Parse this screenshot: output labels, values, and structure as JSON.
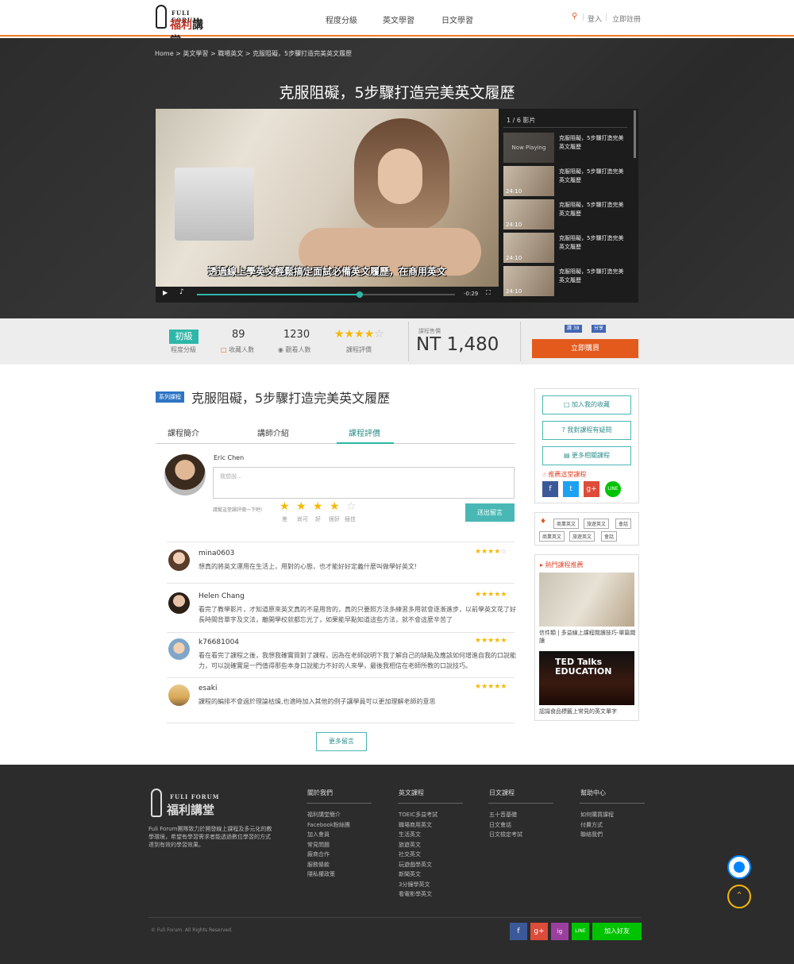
{
  "header": {
    "logo_en": "FULI FORUM",
    "logo_zh_a": "福利",
    "logo_zh_b": "講堂",
    "nav": [
      "程度分級",
      "英文學習",
      "日文學習"
    ],
    "login": "登入",
    "register": "立即註冊",
    "divider": "|"
  },
  "breadcrumb": "Home > 英文學習 > 職場英文 > 克服阻礙，5步驟打造完美英文履歷",
  "course_title": "克服阻礙，5步驟打造完美英文履歷",
  "video": {
    "subtitle": "透過線上學英文輕鬆搞定面試必備英文履歷，在商用英文",
    "time": "-0:29",
    "progress": 0.63
  },
  "playlist": {
    "header": "1 / 6 影片",
    "now_playing": "Now Playing",
    "items": [
      {
        "title": "克服阻礙，5步驟打造完美英文履歷",
        "duration": ""
      },
      {
        "title": "克服阻礙，5步驟打造完美英文履歷",
        "duration": "24:10"
      },
      {
        "title": "克服阻礙，5步驟打造完美英文履歷",
        "duration": "24:10"
      },
      {
        "title": "克服阻礙，5步驟打造完美英文履歷",
        "duration": "24:10"
      },
      {
        "title": "克服阻礙，5步驟打造完美英文履歷",
        "duration": "24:10"
      }
    ]
  },
  "info": {
    "level": "初級",
    "level_label": "程度分級",
    "favorites": "89",
    "favorites_label": "收藏人數",
    "views": "1230",
    "views_label": "觀看人數",
    "rating_label": "課程評價",
    "rating": 4,
    "price_label": "課程售價",
    "price": "NT 1,480",
    "like_label": "讚 38",
    "share_label": "分享",
    "buy_label": "立即購買"
  },
  "main": {
    "series_badge": "系列課程",
    "title": "克服阻礙，5步驟打造完美英文履歷",
    "tabs": [
      "課程簡介",
      "講師介紹",
      "課程評價"
    ],
    "active_tab": 2,
    "commenter": "Eric Chen",
    "comment_placeholder": "我想說...",
    "rate_prompt": "請幫這堂課評價一下吧!",
    "rate_scale": [
      "差",
      "尚可",
      "好",
      "很好",
      "極佳"
    ],
    "submit_label": "送出留言",
    "more_label": "更多留言"
  },
  "reviews": [
    {
      "name": "mina0603",
      "stars": 4,
      "text": "想真的將英文運用在生活上，用對的心態，也才能好好定義什麼叫做學好英文!"
    },
    {
      "name": "Helen Chang",
      "stars": 5,
      "text": "看完了教學影片，才知道原來英文真的不是用背的，真的只要照方法多練習多用就會逐漸進步，以前學英文花了好長時間背單字及文法，離開學校就都忘光了，如果能早點知道這些方法，就不會這麼辛苦了"
    },
    {
      "name": "k76681004",
      "stars": 5,
      "text": "看在看完了課程之後，我想我確實買對了課程，因為在老師說明下我了解自己的缺點及應該如何增進自我的口說能力，可以說確實是一門值得那些本身口說能力不好的人來學，最後我相信在老師所教的口說技巧。"
    },
    {
      "name": "esaki",
      "stars": 5,
      "text": "課程的編排不會過於理論枯燥,也適時加入其他的例子讓學員可以更加理解老師的意思"
    }
  ],
  "sidebar": {
    "buttons": [
      "加入我的收藏",
      "我對課程有疑問",
      "更多相關課程"
    ],
    "recommend_head": "推薦這堂課程",
    "social": [
      "f",
      "t",
      "g+",
      "LINE"
    ],
    "tags": [
      "商業英文",
      "旅遊英文",
      "會話",
      "商業英文",
      "旅遊英文",
      "會話"
    ],
    "hot_head": "熱門課程推薦",
    "hot": [
      {
        "caption": "信件類 | 多益線上課程閱讀技巧-單篇閱讀",
        "image_text": ""
      },
      {
        "caption": "認識食品標籤上常見的英文單字",
        "image_text": "TED Talks EDUCATION"
      }
    ]
  },
  "footer": {
    "logo_en": "FULI FORUM",
    "logo_zh": "福利講堂",
    "desc": "Fuli Forum團隊致力於開發線上課程及多元化的教學環境，希望有學習需求者能透過數位學習的方式達到有效的學習效果。",
    "cols": [
      {
        "head": "關於我們",
        "links": [
          "福利講堂簡介",
          "Facebook粉絲團",
          "加入會員",
          "常見問題",
          "廠商合作",
          "服務條款",
          "隱私權政策"
        ]
      },
      {
        "head": "英文課程",
        "links": [
          "TOEIC多益考試",
          "職場商用英文",
          "生活英文",
          "旅遊英文",
          "社交英文",
          "玩遊戲學英文",
          "新聞英文",
          "3分鐘學英文",
          "看電影學英文"
        ]
      },
      {
        "head": "日文課程",
        "links": [
          "五十音基礎",
          "日文會話",
          "日文檢定考試"
        ]
      },
      {
        "head": "幫助中心",
        "links": [
          "如何購買課程",
          "付費方式",
          "聯絡我們"
        ]
      }
    ],
    "copyright": "© Fuli Forum. All Rights Reserved.",
    "social": [
      "f",
      "g+",
      "ig",
      "LINE"
    ],
    "add_friend": "加入好友"
  },
  "colors": {
    "accent": "#f07a26",
    "teal": "#2eb7a8",
    "buy": "#e35a1c",
    "star": "#f5b800"
  }
}
